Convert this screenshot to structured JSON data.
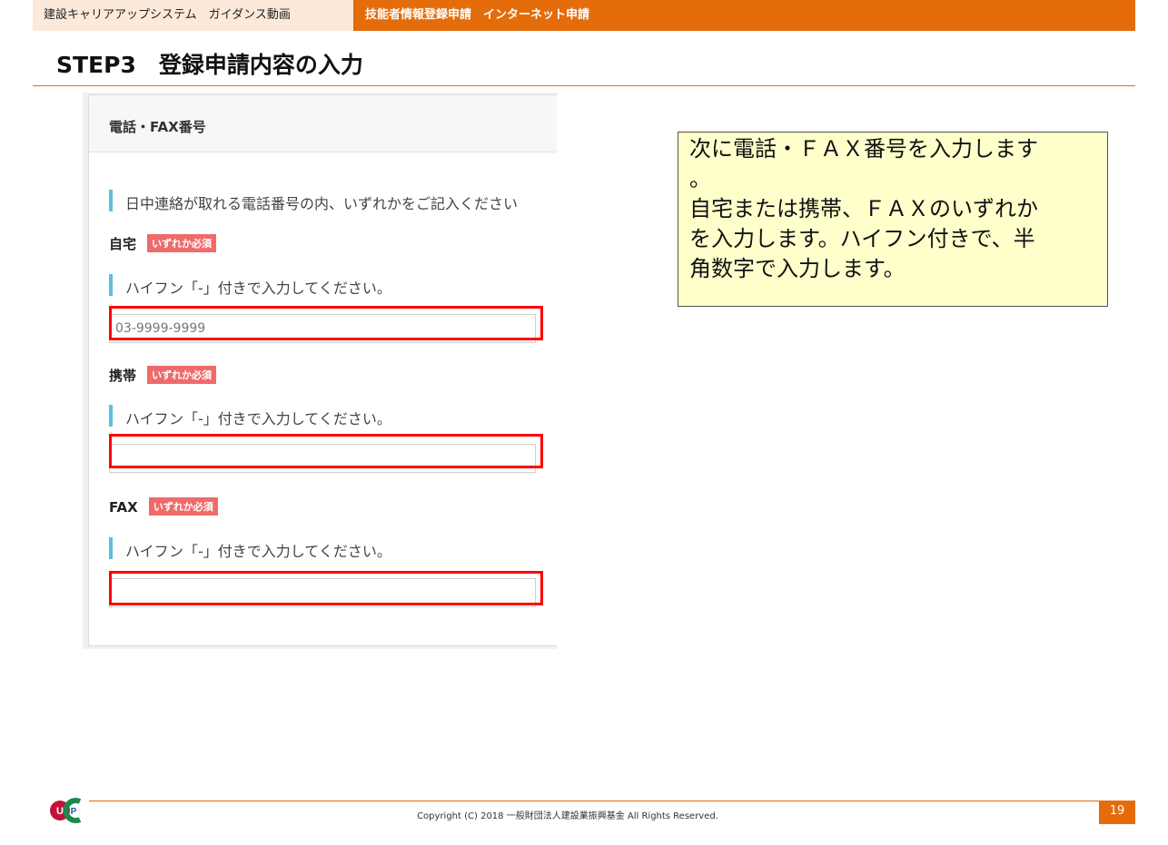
{
  "header": {
    "left_label": "建設キャリアアップシステム　ガイダンス動画",
    "right_label": "技能者情報登録申請　インターネット申請"
  },
  "step_title": "STEP3　登録申請内容の入力",
  "form": {
    "section_title": "電話・FAX番号",
    "intro_note": "日中連絡が取れる電話番号の内、いずれかをご記入ください",
    "fields": [
      {
        "label": "自宅",
        "badge": "いずれか必須",
        "hint": "ハイフン「-」付きで入力してください。",
        "placeholder": "03-9999-9999"
      },
      {
        "label": "携帯",
        "badge": "いずれか必須",
        "hint": "ハイフン「-」付きで入力してください。",
        "placeholder": ""
      },
      {
        "label": "FAX",
        "badge": "いずれか必須",
        "hint": "ハイフン「-」付きで入力してください。",
        "placeholder": ""
      }
    ]
  },
  "callout": {
    "line1": "次に電話・ＦＡＸ番号を入力します",
    "line2": "。",
    "line3": "自宅または携帯、ＦＡＸのいずれか",
    "line4": "を入力します。ハイフン付きで、半",
    "line5": "角数字で入力します。"
  },
  "footer": {
    "copyright": "Copyright (C) 2018 一般財団法人建設業振興基金 All Rights Reserved.",
    "page_number": "19"
  },
  "colors": {
    "accent": "#e46c0a",
    "highlight": "#ff0000",
    "callout_bg": "#ffffcc",
    "badge": "#ef6b6b"
  },
  "icons": {
    "logo": "ccus-logo-icon"
  }
}
